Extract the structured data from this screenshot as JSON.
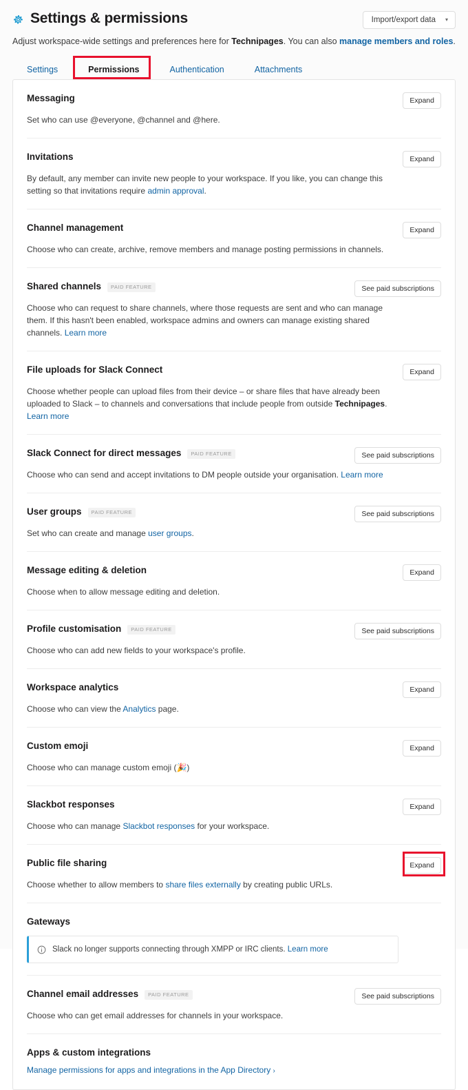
{
  "header": {
    "gear_icon": "gear-icon",
    "title": "Settings & permissions",
    "import_export_label": "Import/export data",
    "import_export_caret": "▾",
    "subtitle_pre": "Adjust workspace-wide settings and preferences here for ",
    "subtitle_workspace": "Technipages",
    "subtitle_mid": ". You can also ",
    "subtitle_link": "manage members and roles",
    "subtitle_end": "."
  },
  "tabs": [
    {
      "label": "Settings",
      "active": false
    },
    {
      "label": "Permissions",
      "active": true
    },
    {
      "label": "Authentication",
      "active": false
    },
    {
      "label": "Attachments",
      "active": false
    }
  ],
  "colors": {
    "accent_blue": "#1264a3",
    "annotation_red": "#e8112d",
    "badge_bg": "#f2f2f2",
    "callout_bar": "#2b9fd8",
    "text_primary": "#1d1c1d",
    "card_bg": "#ffffff",
    "page_bg": "#fbfbfb"
  },
  "buttons": {
    "expand": "Expand",
    "see_paid": "See paid subscriptions"
  },
  "badge_label": "PAID FEATURE",
  "sections": [
    {
      "title": "Messaging",
      "badge": null,
      "button": "Expand",
      "desc_pre": "Set who can use @everyone, @channel and @here.",
      "desc_link": null,
      "desc_post": null
    },
    {
      "title": "Invitations",
      "badge": null,
      "button": "Expand",
      "desc_pre": "By default, any member can invite new people to your workspace. If you like, you can change this setting so that invitations require ",
      "desc_link": "admin approval",
      "desc_post": "."
    },
    {
      "title": "Channel management",
      "badge": null,
      "button": "Expand",
      "desc_pre": "Choose who can create, archive, remove members and manage posting permissions in channels.",
      "desc_link": null,
      "desc_post": null
    },
    {
      "title": "Shared channels",
      "badge": "PAID FEATURE",
      "button": "See paid subscriptions",
      "desc_pre": "Choose who can request to share channels, where those requests are sent and who can manage them. If this hasn't been enabled, workspace admins and owners can manage existing shared channels. ",
      "desc_link": "Learn more",
      "desc_post": ""
    },
    {
      "title": "File uploads for Slack Connect",
      "badge": null,
      "button": "Expand",
      "desc_pre": "Choose whether people can upload files from their device – or share files that have already been uploaded to Slack – to channels and conversations that include people from outside ",
      "desc_bold": "Technipages",
      "desc_mid": ". ",
      "desc_link": "Learn more",
      "desc_post": ""
    },
    {
      "title": "Slack Connect for direct messages",
      "badge": "PAID FEATURE",
      "button": "See paid subscriptions",
      "desc_pre": "Choose who can send and accept invitations to DM people outside your organisation. ",
      "desc_link": "Learn more",
      "desc_post": ""
    },
    {
      "title": "User groups",
      "badge": "PAID FEATURE",
      "button": "See paid subscriptions",
      "desc_pre": "Set who can create and manage ",
      "desc_link": "user groups",
      "desc_post": "."
    },
    {
      "title": "Message editing & deletion",
      "badge": null,
      "button": "Expand",
      "desc_pre": "Choose when to allow message editing and deletion.",
      "desc_link": null,
      "desc_post": null
    },
    {
      "title": "Profile customisation",
      "badge": "PAID FEATURE",
      "button": "See paid subscriptions",
      "desc_pre": "Choose who can add new fields to your workspace's profile.",
      "desc_link": null,
      "desc_post": null
    },
    {
      "title": "Workspace analytics",
      "badge": null,
      "button": "Expand",
      "desc_pre": "Choose who can view the ",
      "desc_link": "Analytics",
      "desc_post": " page."
    },
    {
      "title": "Custom emoji",
      "badge": null,
      "button": "Expand",
      "desc_pre": "Choose who can manage custom emoji (🎉)",
      "desc_link": null,
      "desc_post": null
    },
    {
      "title": "Slackbot responses",
      "badge": null,
      "button": "Expand",
      "desc_pre": "Choose who can manage ",
      "desc_link": "Slackbot responses",
      "desc_post": " for your workspace."
    },
    {
      "title": "Public file sharing",
      "badge": null,
      "button": "Expand",
      "desc_pre": "Choose whether to allow members to ",
      "desc_link": "share files externally",
      "desc_post": " by creating public URLs.",
      "annotated": true
    },
    {
      "title": "Gateways",
      "badge": null,
      "button": null,
      "callout": {
        "icon": "info-circle-icon",
        "text_pre": "Slack no longer supports connecting through XMPP or IRC clients. ",
        "link": "Learn more"
      }
    },
    {
      "title": "Channel email addresses",
      "badge": "PAID FEATURE",
      "button": "See paid subscriptions",
      "desc_pre": "Choose who can get email addresses for channels in your workspace.",
      "desc_link": null,
      "desc_post": null
    },
    {
      "title": "Apps & custom integrations",
      "badge": null,
      "button": null,
      "apps_link": "Manage permissions for apps and integrations in the App Directory",
      "apps_chevron": "›"
    }
  ]
}
